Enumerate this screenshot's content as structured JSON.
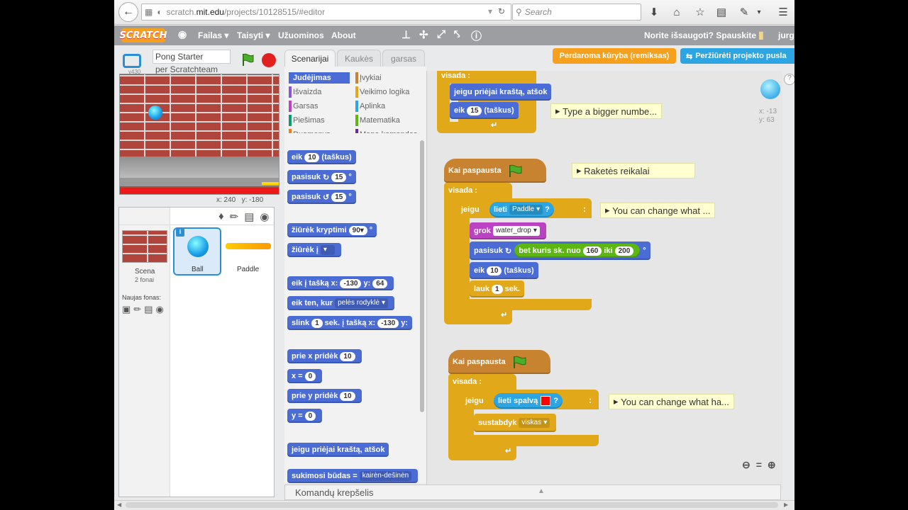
{
  "browser": {
    "url_prefix": "scratch.",
    "url_domain": "mit.edu",
    "url_path": "/projects/10128515/#editor",
    "search_placeholder": "Search"
  },
  "scratch_menu": {
    "logo": "SCRATCH",
    "file": "Failas ▾",
    "edit": "Taisyti ▾",
    "tips": "Užuominos",
    "about": "About",
    "save_prompt": "Norite išsaugoti? Spauskite",
    "user": "jurgi"
  },
  "buttons": {
    "remix": "Perdaroma kūryba (remiksas)",
    "see_page": "Peržiūrėti projekto pusla"
  },
  "stage": {
    "project_title": "Pong Starter",
    "author": "per Scratchteam",
    "version": "v430",
    "coords": "x: 240   y: -180"
  },
  "sprites": {
    "scene_label": "Scena",
    "scene_sub": "2 fonai",
    "new_backdrop": "Naujas fonas:",
    "items": [
      {
        "name": "Ball"
      },
      {
        "name": "Paddle"
      }
    ]
  },
  "tabs": [
    "Scenarijai",
    "Kaukės",
    "garsas"
  ],
  "categories": [
    {
      "label": "Judėjimas",
      "color": "#4a6cd4",
      "active": true
    },
    {
      "label": "Įvykiai",
      "color": "#c88330"
    },
    {
      "label": "Išvaizda",
      "color": "#8a55d7"
    },
    {
      "label": "Veikimo logika",
      "color": "#e1a91a"
    },
    {
      "label": "Garsas",
      "color": "#bb42c3"
    },
    {
      "label": "Aplinka",
      "color": "#2ca5e2"
    },
    {
      "label": "Piešimas",
      "color": "#0e9a6c"
    },
    {
      "label": "Matematika",
      "color": "#5cb712"
    },
    {
      "label": "Duomenys",
      "color": "#ee7d16"
    },
    {
      "label": "Mano komandos",
      "color": "#632d99"
    }
  ],
  "palette": {
    "move": "eik",
    "move_n": "10",
    "move_u": "(taškus)",
    "turn_r": "pasisuk",
    "turn_r_n": "15",
    "turn_l": "pasisuk",
    "turn_l_n": "15",
    "point_dir": "žiūrėk kryptimi",
    "point_dir_n": "90▾",
    "point_to": "žiūrėk į",
    "goto_xy": "eik į tašką x:",
    "goto_x": "-130",
    "goto_y_l": "y:",
    "goto_y": "64",
    "goto": "eik ten, kur",
    "goto_v": "pelės rodyklė",
    "glide": "slink",
    "glide_n": "1",
    "glide_t": "sek. į tašką x:",
    "glide_x": "-130",
    "glide_y": "y:",
    "change_x": "prie x pridėk",
    "change_x_n": "10",
    "set_x": "x =",
    "set_x_n": "0",
    "change_y": "prie y pridėk",
    "change_y_n": "10",
    "set_y": "y =",
    "set_y_n": "0",
    "bounce": "jeigu priėjai kraštą, atšok",
    "rot": "sukimosi būdas =",
    "rot_v": "kairėn-dešinėn"
  },
  "script1": {
    "forever": "visada",
    "bounce": "jeigu priėjai kraštą, atšok",
    "move": "eik",
    "move_n": "15",
    "move_u": "(taškus)",
    "comment": "Type a bigger numbe..."
  },
  "script2": {
    "hat": "Kai paspausta",
    "forever": "visada",
    "if": "jeigu",
    "touch": "lieti",
    "touch_v": "Paddle",
    "q": "?",
    "then": ":",
    "play": "grok",
    "play_v": "water_drop",
    "turn": "pasisuk",
    "rand": "bet kuris sk. nuo",
    "rand_a": "160",
    "rand_to": "iki",
    "rand_b": "200",
    "deg": "°",
    "move": "eik",
    "move_n": "10",
    "move_u": "(taškus)",
    "wait": "lauk",
    "wait_n": "1",
    "wait_u": "sek.",
    "comment_top": "Raketės reikalai",
    "comment_if": "You can change what ..."
  },
  "script3": {
    "hat": "Kai paspausta",
    "forever": "visada",
    "if": "jeigu",
    "touch": "lieti spalvą",
    "q": "?",
    "then": ":",
    "stop": "sustabdyk",
    "stop_v": "viskas",
    "comment": "You can change what ha..."
  },
  "sprite_info": {
    "x": "x: -13",
    "y": "y: 63"
  },
  "basket": "Komandų krepšelis"
}
